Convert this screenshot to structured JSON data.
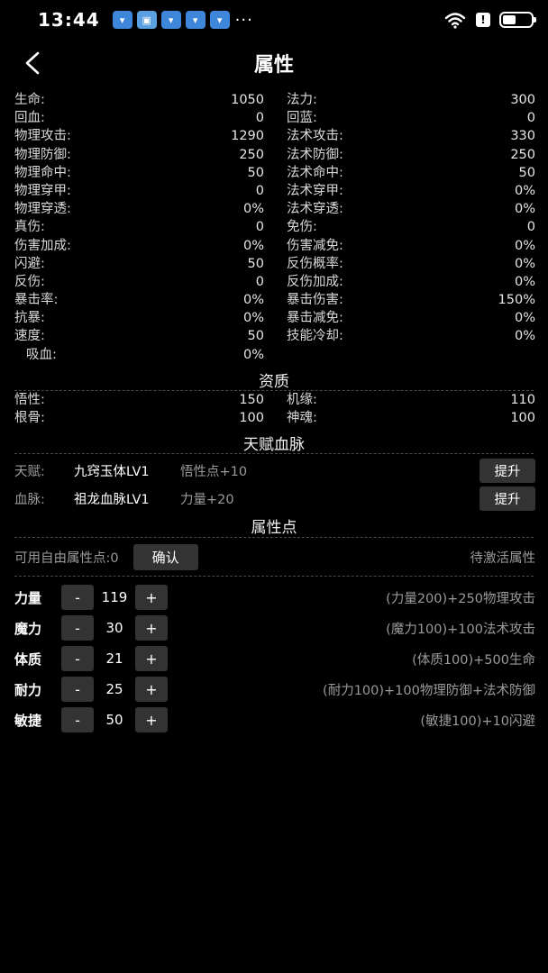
{
  "status_bar": {
    "time": "13:44",
    "more": "···",
    "alert": "!"
  },
  "header": {
    "title": "属性"
  },
  "stats": [
    [
      {
        "label": "生命:",
        "value": "1050"
      },
      {
        "label": "法力:",
        "value": "300"
      }
    ],
    [
      {
        "label": "回血:",
        "value": "0"
      },
      {
        "label": "回蓝:",
        "value": "0"
      }
    ],
    [
      {
        "label": "物理攻击:",
        "value": "1290"
      },
      {
        "label": "法术攻击:",
        "value": "330"
      }
    ],
    [
      {
        "label": "物理防御:",
        "value": "250"
      },
      {
        "label": "法术防御:",
        "value": "250"
      }
    ],
    [
      {
        "label": "物理命中:",
        "value": "50"
      },
      {
        "label": "法术命中:",
        "value": "50"
      }
    ],
    [
      {
        "label": "物理穿甲:",
        "value": "0"
      },
      {
        "label": "法术穿甲:",
        "value": "0%"
      }
    ],
    [
      {
        "label": "物理穿透:",
        "value": "0%"
      },
      {
        "label": "法术穿透:",
        "value": "0%"
      }
    ],
    [
      {
        "label": "真伤:",
        "value": "0"
      },
      {
        "label": "免伤:",
        "value": "0"
      }
    ],
    [
      {
        "label": "伤害加成:",
        "value": "0%"
      },
      {
        "label": "伤害减免:",
        "value": "0%"
      }
    ],
    [
      {
        "label": "闪避:",
        "value": "50"
      },
      {
        "label": "反伤概率:",
        "value": "0%"
      }
    ],
    [
      {
        "label": "反伤:",
        "value": "0"
      },
      {
        "label": "反伤加成:",
        "value": "0%"
      }
    ],
    [
      {
        "label": "暴击率:",
        "value": "0%"
      },
      {
        "label": "暴击伤害:",
        "value": "150%"
      }
    ],
    [
      {
        "label": "抗暴:",
        "value": "0%"
      },
      {
        "label": "暴击减免:",
        "value": "0%"
      }
    ],
    [
      {
        "label": "速度:",
        "value": "50"
      },
      {
        "label": "技能冷却:",
        "value": "0%"
      }
    ],
    [
      {
        "label": "吸血:",
        "value": "0%"
      }
    ]
  ],
  "aptitude": {
    "title": "资质",
    "rows": [
      [
        {
          "label": "悟性:",
          "value": "150"
        },
        {
          "label": "机缘:",
          "value": "110"
        }
      ],
      [
        {
          "label": "根骨:",
          "value": "100"
        },
        {
          "label": "神魂:",
          "value": "100"
        }
      ]
    ]
  },
  "talent_section": {
    "title": "天赋血脉",
    "upgrade_label": "提升",
    "rows": [
      {
        "label": "天赋:",
        "name": "九窍玉体LV1",
        "effect": "悟性点+10"
      },
      {
        "label": "血脉:",
        "name": "祖龙血脉LV1",
        "effect": "力量+20"
      }
    ]
  },
  "points_section": {
    "title": "属性点",
    "free_points": "可用自由属性点:0",
    "confirm_label": "确认",
    "pending_label": "待激活属性",
    "minus": "-",
    "plus": "+",
    "attributes": [
      {
        "name": "力量",
        "value": "119",
        "desc": "(力量200)+250物理攻击"
      },
      {
        "name": "魔力",
        "value": "30",
        "desc": "(魔力100)+100法术攻击"
      },
      {
        "name": "体质",
        "value": "21",
        "desc": "(体质100)+500生命"
      },
      {
        "name": "耐力",
        "value": "25",
        "desc": "(耐力100)+100物理防御+法术防御"
      },
      {
        "name": "敏捷",
        "value": "50",
        "desc": "(敏捷100)+10闪避"
      }
    ]
  },
  "icons": {
    "back": "chevron-left-icon",
    "wifi": "wifi-icon",
    "battery": "battery-icon"
  },
  "colors": {
    "background": "#000000",
    "button": "#333333",
    "muted_text": "#9a9a9a",
    "notif_blue": "#3d86d9"
  }
}
